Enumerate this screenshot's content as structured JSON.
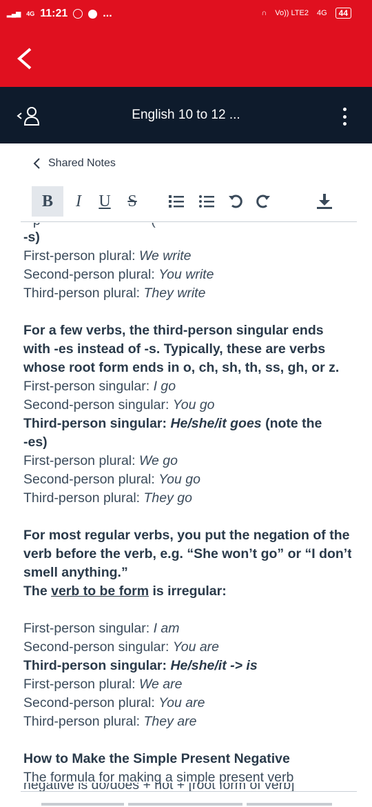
{
  "status_bar": {
    "time": "11:21",
    "network": "4G",
    "volte": "Vo)) LTE2",
    "network2": "4G",
    "battery": "44",
    "more": "..."
  },
  "app_bar": {
    "back_icon": "chevron-left-icon"
  },
  "nav": {
    "title": "English 10 to 12 ...",
    "user_icon": "person-icon",
    "menu_icon": "kebab-icon"
  },
  "breadcrumb": {
    "label": "Shared Notes"
  },
  "toolbar": {
    "bold": "B",
    "italic": "I",
    "underline": "U",
    "strike": "S",
    "olist": "≡",
    "ulist": "☰",
    "undo": "↶",
    "redo": "↷",
    "download_icon": "download-icon"
  },
  "colors": {
    "accent": "#e0101f",
    "navbar": "#0e1b2c",
    "text": "#2a3a4a"
  },
  "note": {
    "clip_top": "  -  p  -  -  -  -  -  -  -  -  -  -  -  (",
    "p1": {
      "cont": "-s)",
      "l1a": "First-person plural: ",
      "l1b": "We write",
      "l2a": "Second-person plural: ",
      "l2b": "You write",
      "l3a": "Third-person plural: ",
      "l3b": "They write"
    },
    "p2": {
      "b1": "For a few verbs, the third-person singular ends",
      "b2": "with -es instead of -s. Typically, these are verbs",
      "b3": "whose root form ends in o, ch, sh, th, ss, gh, or z.",
      "l1a": "First-person singular: ",
      "l1b": "I go",
      "l2a": "Second-person singular: ",
      "l2b": "You go",
      "l3a": "Third-person singular: ",
      "l3b": "He/she/it goes",
      "l3c": " (note the",
      "l3d": "-es)",
      "l4a": "First-person plural: ",
      "l4b": "We go",
      "l5a": "Second-person plural: ",
      "l5b": "You go",
      "l6a": "Third-person plural: ",
      "l6b": "They go"
    },
    "p3": {
      "b1": "For most regular verbs, you put the negation of the",
      "b2": "verb before the verb, e.g. “She won’t go” or “I don’t",
      "b3": "smell anything.”",
      "b4a": "The ",
      "b4b": "verb to be form",
      "b4c": " is irregular:"
    },
    "p4": {
      "l1a": "First-person singular: ",
      "l1b": "I am",
      "l2a": "Second-person singular: ",
      "l2b": "You are",
      "l3a": "Third-person singular: ",
      "l3b": "He/she/it -> is",
      "l4a": "First-person plural: ",
      "l4b": "We are",
      "l5a": "Second-person plural: ",
      "l5b": "You are",
      "l6a": "Third-person plural: ",
      "l6b": "They are"
    },
    "p5": {
      "heading": "How to Make the Simple Present Negative",
      "l1": "The formula for making a simple present verb",
      "l2": "negative is do/does + not + [root form of verb]"
    }
  }
}
